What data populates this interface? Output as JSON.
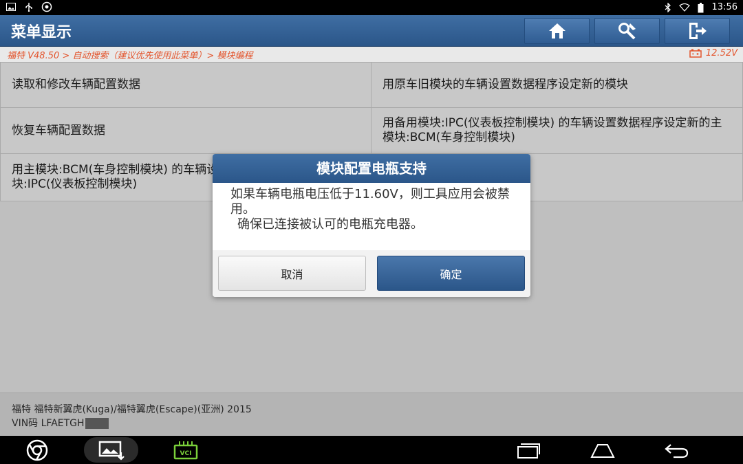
{
  "status_bar": {
    "time": "13:56",
    "left_icons": [
      "gallery-icon",
      "usb-icon",
      "settings-icon"
    ],
    "right_icons": [
      "bluetooth-icon",
      "wifi-icon",
      "battery-icon"
    ]
  },
  "header": {
    "title": "菜单显示",
    "buttons": [
      "home-icon",
      "diagnose-tool-icon",
      "exit-icon"
    ]
  },
  "breadcrumb": {
    "path": "福特 V48.50 > 自动搜索（建议优先使用此菜单）> 模块编程",
    "voltage": "12.52V"
  },
  "menu": {
    "items": [
      {
        "label": "读取和修改车辆配置数据"
      },
      {
        "label": "用原车旧模块的车辆设置数据程序设定新的模块"
      },
      {
        "label": "恢复车辆配置数据"
      },
      {
        "label": "用备用模块:IPC(仪表板控制模块) 的车辆设置数据程序设定新的主模块:BCM(车身控制模块)"
      },
      {
        "label": "用主模块:BCM(车身控制模块) 的车辆设置数据程序设定新的备用模块:IPC(仪表板控制模块)"
      },
      {
        "label": ""
      }
    ]
  },
  "dialog": {
    "title": "模块配置电瓶支持",
    "message_line1": "如果车辆电瓶电压低于11.60V，则工具应用会被禁用。",
    "message_line2": "确保已连接被认可的电瓶充电器。",
    "cancel_label": "取消",
    "ok_label": "确定"
  },
  "vehicle_info": {
    "model": "福特 福特新翼虎(Kuga)/福特翼虎(Escape)(亚洲) 2015",
    "vin_label": "VIN码 LFAETGH"
  },
  "nav_bar": {
    "vci_label": "VCI",
    "icons": [
      "browser-icon",
      "screenshot-icon",
      "vci-icon",
      "recent-apps-icon",
      "home-nav-icon",
      "back-icon"
    ]
  },
  "colors": {
    "header_blue": "#2b5689",
    "breadcrumb_orange": "#e3542c",
    "vci_green": "#7ad03a"
  }
}
